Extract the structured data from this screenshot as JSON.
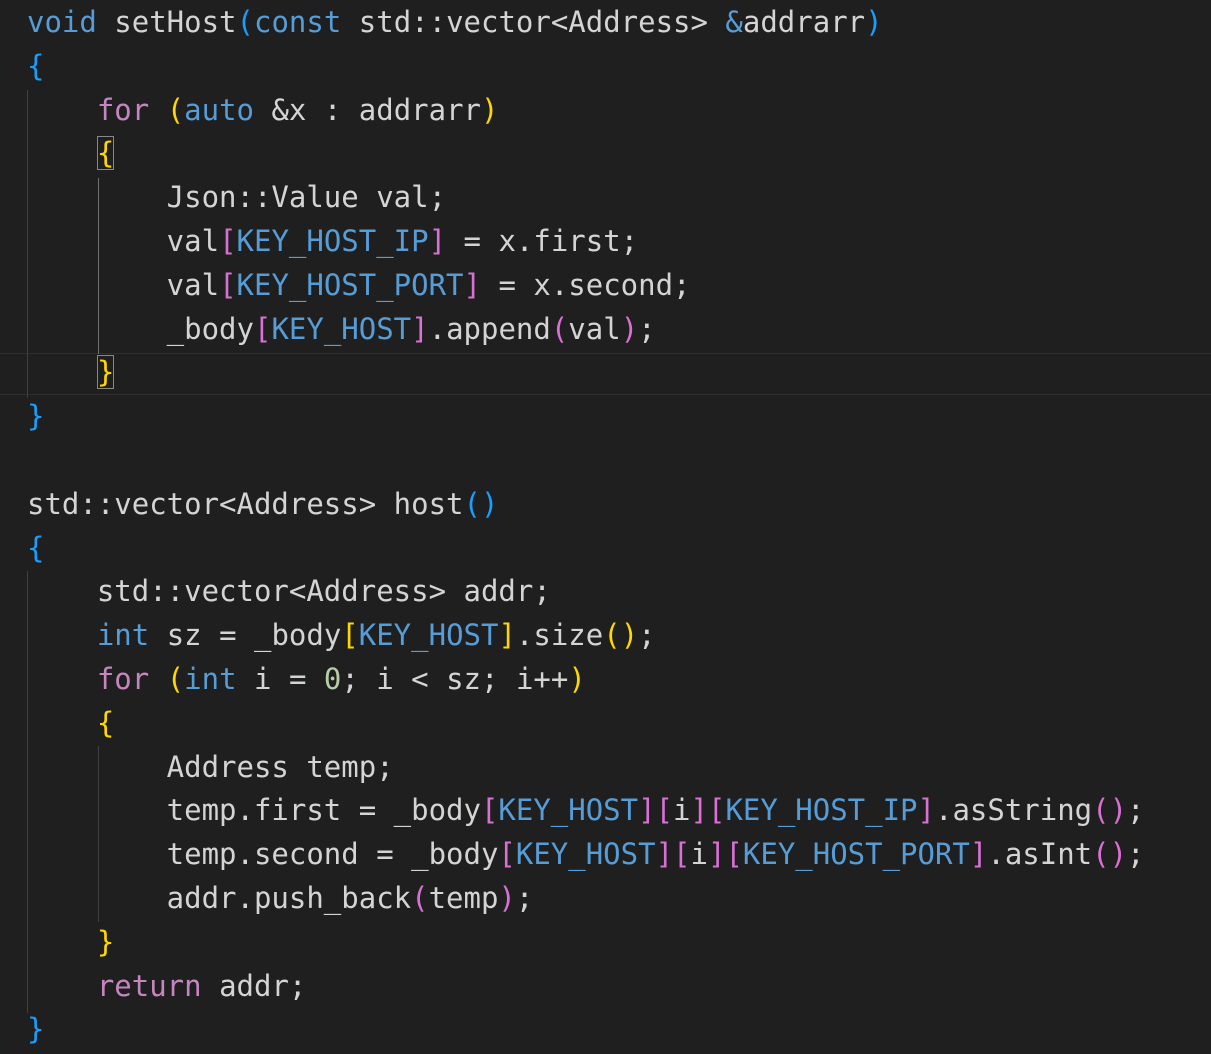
{
  "editor": {
    "lines": [
      [
        {
          "t": "void",
          "c": "kw"
        },
        {
          "t": " setHost"
        },
        {
          "t": "(",
          "c": "b3"
        },
        {
          "t": "const",
          "c": "kw"
        },
        {
          "t": " std::vector<Address> "
        },
        {
          "t": "&",
          "c": "kw"
        },
        {
          "t": "addrarr"
        },
        {
          "t": ")",
          "c": "b3"
        }
      ],
      [
        {
          "t": "{",
          "c": "b3"
        }
      ],
      [
        {
          "t": "    "
        },
        {
          "t": "for",
          "c": "ctl"
        },
        {
          "t": " "
        },
        {
          "t": "(",
          "c": "b1"
        },
        {
          "t": "auto",
          "c": "kw"
        },
        {
          "t": " &x : addrarr"
        },
        {
          "t": ")",
          "c": "b1"
        }
      ],
      [
        {
          "t": "    "
        },
        {
          "t": "{",
          "c": "b1",
          "box": true
        }
      ],
      [
        {
          "t": "        Json::Value val;"
        }
      ],
      [
        {
          "t": "        val"
        },
        {
          "t": "[",
          "c": "b2"
        },
        {
          "t": "KEY_HOST_IP",
          "c": "kw"
        },
        {
          "t": "]",
          "c": "b2"
        },
        {
          "t": " = x.first;"
        }
      ],
      [
        {
          "t": "        val"
        },
        {
          "t": "[",
          "c": "b2"
        },
        {
          "t": "KEY_HOST_PORT",
          "c": "kw"
        },
        {
          "t": "]",
          "c": "b2"
        },
        {
          "t": " = x.second;"
        }
      ],
      [
        {
          "t": "        _body"
        },
        {
          "t": "[",
          "c": "b2"
        },
        {
          "t": "KEY_HOST",
          "c": "kw"
        },
        {
          "t": "]",
          "c": "b2"
        },
        {
          "t": ".append"
        },
        {
          "t": "(",
          "c": "b2"
        },
        {
          "t": "val"
        },
        {
          "t": ")",
          "c": "b2"
        },
        {
          "t": ";"
        }
      ],
      [
        {
          "t": "    "
        },
        {
          "t": "}",
          "c": "b1",
          "box": true
        }
      ],
      [
        {
          "t": "}",
          "c": "b3"
        }
      ],
      [],
      [
        {
          "t": "std::vector<Address> host"
        },
        {
          "t": "()",
          "c": "b3"
        }
      ],
      [
        {
          "t": "{",
          "c": "b3"
        }
      ],
      [
        {
          "t": "    std::vector<Address> addr;"
        }
      ],
      [
        {
          "t": "    "
        },
        {
          "t": "int",
          "c": "kw"
        },
        {
          "t": " sz = _body"
        },
        {
          "t": "[",
          "c": "b1"
        },
        {
          "t": "KEY_HOST",
          "c": "kw"
        },
        {
          "t": "]",
          "c": "b1"
        },
        {
          "t": ".size"
        },
        {
          "t": "()",
          "c": "b1"
        },
        {
          "t": ";"
        }
      ],
      [
        {
          "t": "    "
        },
        {
          "t": "for",
          "c": "ctl"
        },
        {
          "t": " "
        },
        {
          "t": "(",
          "c": "b1"
        },
        {
          "t": "int",
          "c": "kw"
        },
        {
          "t": " i = "
        },
        {
          "t": "0",
          "c": "num"
        },
        {
          "t": "; i < sz; i++"
        },
        {
          "t": ")",
          "c": "b1"
        }
      ],
      [
        {
          "t": "    "
        },
        {
          "t": "{",
          "c": "b1"
        }
      ],
      [
        {
          "t": "        Address temp;"
        }
      ],
      [
        {
          "t": "        temp.first = _body"
        },
        {
          "t": "[",
          "c": "b2"
        },
        {
          "t": "KEY_HOST",
          "c": "kw"
        },
        {
          "t": "]",
          "c": "b2"
        },
        {
          "t": "[",
          "c": "b2"
        },
        {
          "t": "i"
        },
        {
          "t": "]",
          "c": "b2"
        },
        {
          "t": "[",
          "c": "b2"
        },
        {
          "t": "KEY_HOST_IP",
          "c": "kw"
        },
        {
          "t": "]",
          "c": "b2"
        },
        {
          "t": ".asString"
        },
        {
          "t": "()",
          "c": "b2"
        },
        {
          "t": ";"
        }
      ],
      [
        {
          "t": "        temp.second = _body"
        },
        {
          "t": "[",
          "c": "b2"
        },
        {
          "t": "KEY_HOST",
          "c": "kw"
        },
        {
          "t": "]",
          "c": "b2"
        },
        {
          "t": "[",
          "c": "b2"
        },
        {
          "t": "i"
        },
        {
          "t": "]",
          "c": "b2"
        },
        {
          "t": "[",
          "c": "b2"
        },
        {
          "t": "KEY_HOST_PORT",
          "c": "kw"
        },
        {
          "t": "]",
          "c": "b2"
        },
        {
          "t": ".asInt"
        },
        {
          "t": "()",
          "c": "b2"
        },
        {
          "t": ";"
        }
      ],
      [
        {
          "t": "        addr.push_back"
        },
        {
          "t": "(",
          "c": "b2"
        },
        {
          "t": "temp"
        },
        {
          "t": ")",
          "c": "b2"
        },
        {
          "t": ";"
        }
      ],
      [
        {
          "t": "    "
        },
        {
          "t": "}",
          "c": "b1"
        }
      ],
      [
        {
          "t": "    "
        },
        {
          "t": "return",
          "c": "ctl"
        },
        {
          "t": " addr;"
        }
      ],
      [
        {
          "t": "}",
          "c": "b3"
        }
      ]
    ]
  },
  "colors": {
    "background": "#1f1f1f",
    "text": "#d4d4d4",
    "keyword": "#569cd6",
    "control": "#c586c0",
    "number": "#b5cea8",
    "bracket_1": "#ffd700",
    "bracket_2": "#da70d6",
    "bracket_3": "#179fff"
  }
}
